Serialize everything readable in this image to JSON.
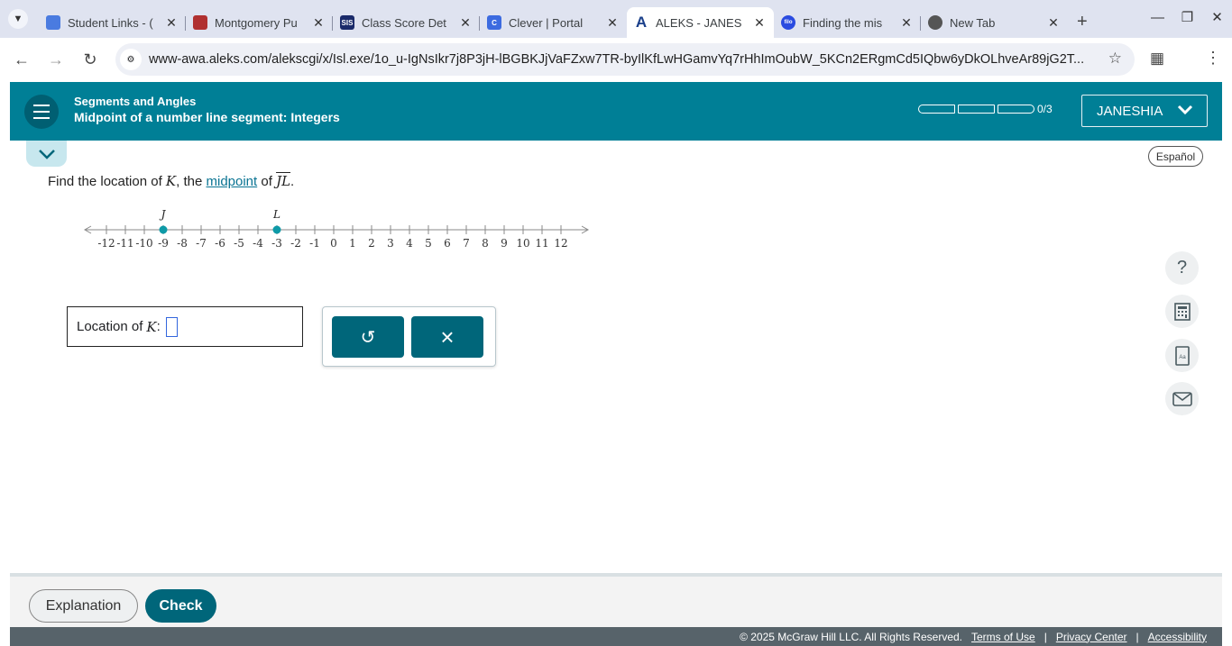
{
  "browser": {
    "tabs": [
      {
        "title": "Student Links - (",
        "icon_color": "#4a7be0",
        "icon_text": ""
      },
      {
        "title": "Montgomery Pu",
        "icon_color": "#b03030",
        "icon_text": ""
      },
      {
        "title": "Class Score Det",
        "icon_color": "#1a2a6a",
        "icon_text": "SIS"
      },
      {
        "title": "Clever | Portal",
        "icon_color": "#3c6be0",
        "icon_text": "C"
      },
      {
        "title": "ALEKS - JANES",
        "icon_color": "#1a3f8a",
        "icon_text": "A"
      },
      {
        "title": "Finding the mis",
        "icon_color": "#2a4be0",
        "icon_text": "filo"
      },
      {
        "title": "New Tab",
        "icon_color": "#555555",
        "icon_text": ""
      }
    ],
    "active_tab_index": 4,
    "url": "www-awa.aleks.com/alekscgi/x/Isl.exe/1o_u-IgNsIkr7j8P3jH-lBGBKJjVaFZxw7TR-byIlKfLwHGamvYq7rHhImOubW_5KCn2ERgmCd5IQbw6yDkOLhveAr89jG2T..."
  },
  "header": {
    "topic": "Segments and Angles",
    "subtopic": "Midpoint of a number line segment: Integers",
    "progress": "0/3",
    "user": "JANESHIA"
  },
  "language_button": "Español",
  "question": {
    "prefix": "Find the location of ",
    "var": "K",
    "middle": ", the ",
    "link": "midpoint",
    "of": " of ",
    "segment": "JL",
    "end": "."
  },
  "number_line": {
    "min": -12,
    "max": 12,
    "points": [
      {
        "label": "J",
        "value": -9
      },
      {
        "label": "L",
        "value": -3
      }
    ]
  },
  "answer": {
    "label": "Location of ",
    "var": "K",
    "colon": " :"
  },
  "tools": {
    "undo": "↺",
    "clear": "×"
  },
  "footer": {
    "explanation": "Explanation",
    "check": "Check",
    "copyright": "© 2025 McGraw Hill LLC. All Rights Reserved.",
    "terms": "Terms of Use",
    "privacy": "Privacy Center",
    "accessibility": "Accessibility"
  }
}
